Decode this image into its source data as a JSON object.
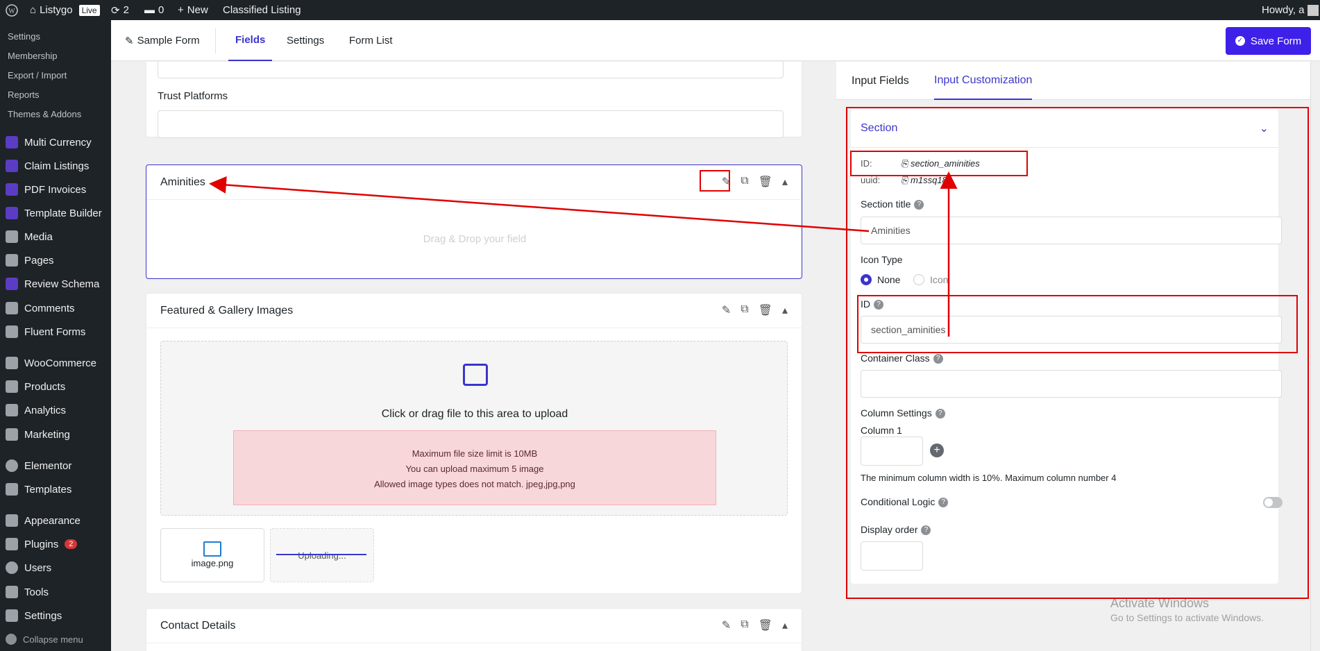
{
  "adminbar": {
    "site": "Listygo",
    "live": "Live",
    "updates": "2",
    "comments": "0",
    "new": "New",
    "classified": "Classified Listing",
    "howdy": "Howdy, a"
  },
  "sidebar": {
    "subitems": [
      "Settings",
      "Membership",
      "Export / Import",
      "Reports",
      "Themes & Addons"
    ],
    "items": [
      {
        "label": "Multi Currency"
      },
      {
        "label": "Claim Listings"
      },
      {
        "label": "PDF Invoices"
      },
      {
        "label": "Template Builder"
      },
      {
        "label": "Media"
      },
      {
        "label": "Pages"
      },
      {
        "label": "Review Schema"
      },
      {
        "label": "Comments"
      },
      {
        "label": "Fluent Forms"
      },
      {
        "label": "WooCommerce"
      },
      {
        "label": "Products"
      },
      {
        "label": "Analytics"
      },
      {
        "label": "Marketing"
      },
      {
        "label": "Elementor"
      },
      {
        "label": "Templates"
      },
      {
        "label": "Appearance"
      },
      {
        "label": "Plugins",
        "badge": "2"
      },
      {
        "label": "Users"
      },
      {
        "label": "Tools"
      },
      {
        "label": "Settings"
      },
      {
        "label": "Collapse menu"
      }
    ]
  },
  "header": {
    "form_name": "Sample Form",
    "tabs": [
      "Fields",
      "Settings",
      "Form List"
    ],
    "save": "Save Form"
  },
  "canvas": {
    "trust_label": "Trust Platforms",
    "aminities": {
      "title": "Aminities",
      "drop": "Drag & Drop your field"
    },
    "gallery": {
      "title": "Featured & Gallery Images",
      "upload": "Click or drag file to this area to upload",
      "errors": [
        "Maximum file size limit is 10MB",
        "You can upload maximum 5 image",
        "Allowed image types does not match. jpeg,jpg,png"
      ],
      "file1": "image.png",
      "file2": "Uploading..."
    },
    "contact": {
      "title": "Contact Details"
    }
  },
  "panel": {
    "tabs": [
      "Input Fields",
      "Input Customization"
    ],
    "section": "Section",
    "id_label": "ID:",
    "id_value": "section_aminities",
    "uuid_label": "uuid:",
    "uuid_value": "m1ssq189",
    "section_title_label": "Section title",
    "section_title_value": "Aminities",
    "icon_type_label": "Icon Type",
    "icon_none": "None",
    "icon_icon": "Icon",
    "id_field_label": "ID",
    "id_field_value": "section_aminities",
    "container_label": "Container Class",
    "column_settings": "Column Settings",
    "column1": "Column 1",
    "column_note": "The minimum column width is 10%. Maximum column number 4",
    "conditional": "Conditional Logic",
    "display_order": "Display order"
  },
  "watermark": {
    "title": "Activate Windows",
    "sub": "Go to Settings to activate Windows."
  }
}
